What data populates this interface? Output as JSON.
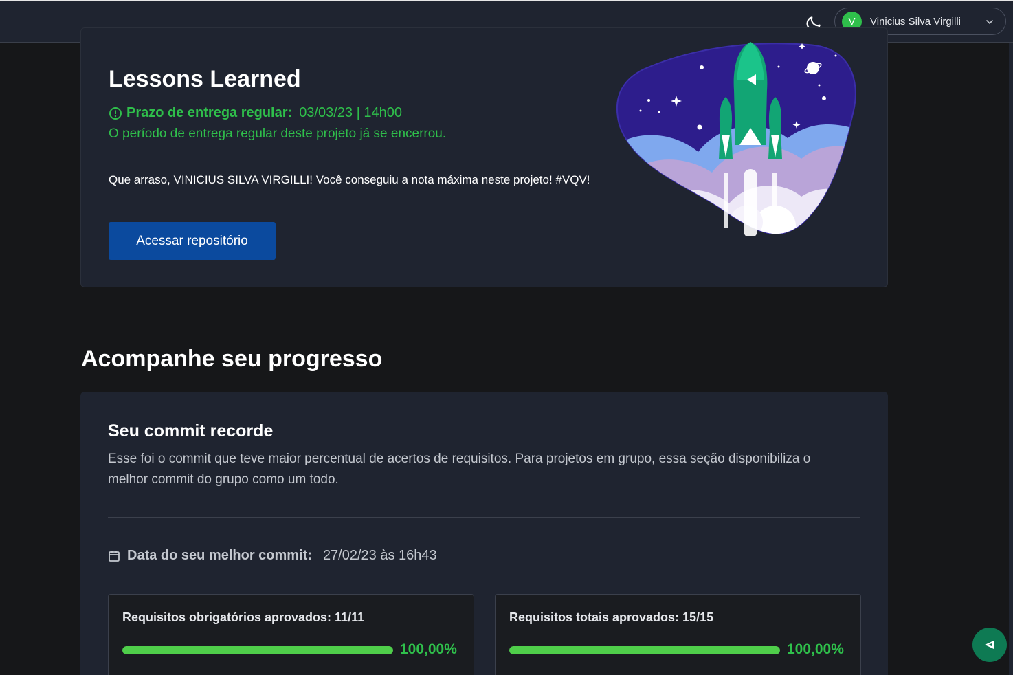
{
  "header": {
    "theme_icon": "moon-icon",
    "user_initial": "V",
    "user_name": "Vinicius Silva Virgilli",
    "dropdown_icon": "chevron-down-icon"
  },
  "project": {
    "title": "Lessons Learned",
    "deadline_icon": "clock-alert-icon",
    "deadline_label": "Prazo de entrega regular:",
    "deadline_value": "03/03/23 | 14h00",
    "deadline_note": "O período de entrega regular deste projeto já se encerrou.",
    "congrats": "Que arraso, VINICIUS SILVA VIRGILLI! Você conseguiu a nota máxima neste projeto! #VQV!",
    "repo_button": "Acessar repositório",
    "illustration": "rocket-launch-illustration"
  },
  "progress": {
    "section_title": "Acompanhe seu progresso",
    "commit_title": "Seu commit recorde",
    "commit_description": "Esse foi o commit que teve maior percentual de acertos de requisitos. Para projetos em grupo, essa seção disponibiliza o melhor commit do grupo como um todo.",
    "best_commit_icon": "calendar-icon",
    "best_commit_label": "Data do seu melhor commit:",
    "best_commit_value": "27/02/23 às 16h43",
    "requirements": [
      {
        "label": "Requisitos obrigatórios aprovados: 11/11",
        "percent_text": "100,00%",
        "fraction": 1.0
      },
      {
        "label": "Requisitos totais aprovados: 15/15",
        "percent_text": "100,00%",
        "fraction": 1.0
      }
    ]
  },
  "fab": {
    "icon": "trybe-logo-icon"
  },
  "colors": {
    "accent_green": "#2fbf4b",
    "button_blue": "#0b4a9e",
    "card_bg": "#1f2430",
    "page_bg": "#161719"
  }
}
